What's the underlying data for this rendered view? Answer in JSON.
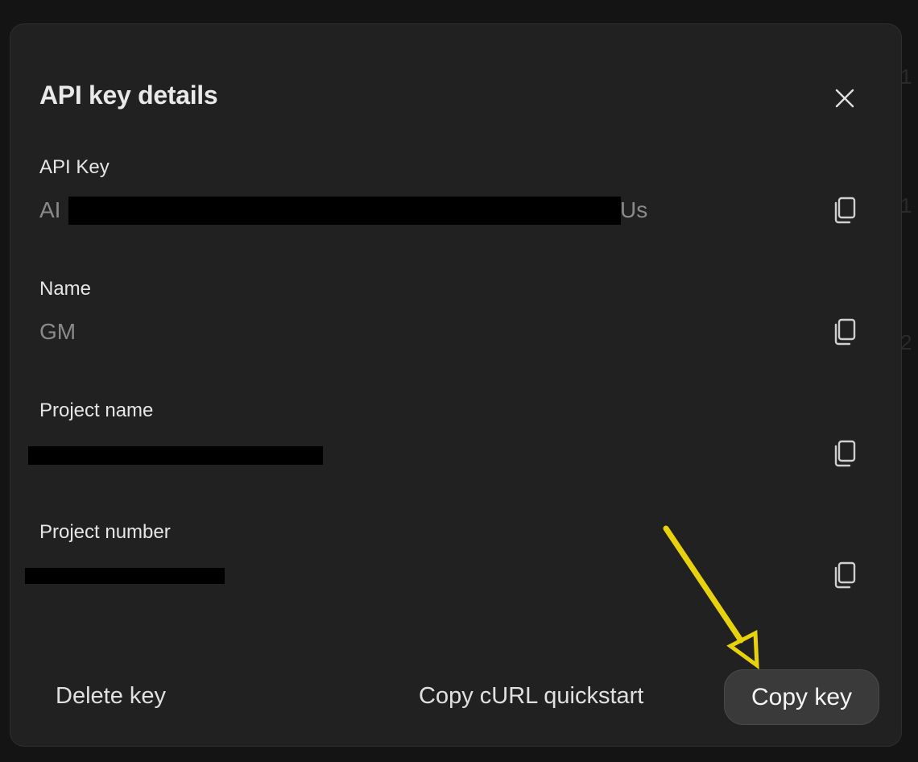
{
  "dialog": {
    "title": "API key details",
    "close_icon": "close-icon"
  },
  "fields": [
    {
      "label": "API Key",
      "value_prefix": "AI",
      "value_suffix": "Us",
      "copy_icon": "copy-icon"
    },
    {
      "label": "Name",
      "value": "GM",
      "copy_icon": "copy-icon"
    },
    {
      "label": "Project name",
      "copy_icon": "copy-icon"
    },
    {
      "label": "Project number",
      "copy_icon": "copy-icon"
    }
  ],
  "footer": {
    "delete_label": "Delete key",
    "curl_label": "Copy cURL quickstart",
    "copy_key_label": "Copy key"
  },
  "colors": {
    "annotation_arrow": "#e8d20e"
  }
}
